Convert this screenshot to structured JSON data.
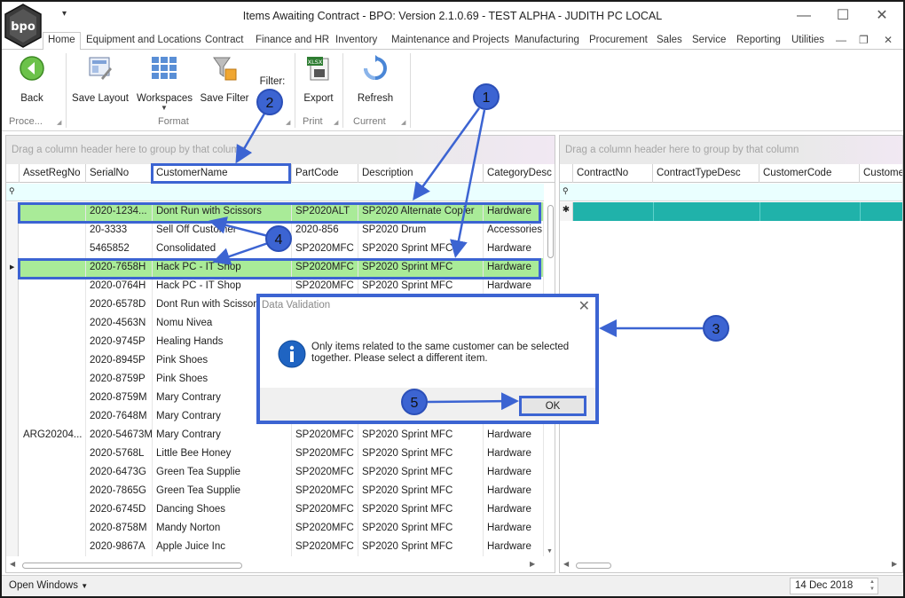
{
  "window": {
    "title": "Items Awaiting Contract - BPO: Version 2.1.0.69 - TEST ALPHA - JUDITH PC LOCAL",
    "logo_text": "bpo",
    "quick_access": "▾",
    "minimize": "—",
    "maximize": "☐",
    "close": "✕"
  },
  "menu": {
    "items": [
      "Home",
      "Equipment and Locations",
      "Contract",
      "Finance and HR",
      "Inventory",
      "Maintenance and Projects",
      "Manufacturing",
      "Procurement",
      "Sales",
      "Service",
      "Reporting",
      "Utilities"
    ],
    "mdi_minimize": "—",
    "mdi_restore": "❐",
    "mdi_close": "✕"
  },
  "ribbon": {
    "back": "Back",
    "save_layout": "Save Layout",
    "workspaces": "Workspaces",
    "save_filter": "Save Filter",
    "filter_label": "Filter:",
    "export": "Export",
    "refresh": "Refresh",
    "groups": {
      "process": "Proce...",
      "format": "Format",
      "print": "Print",
      "current": "Current"
    },
    "xlsx_badge": "XLSX"
  },
  "left_grid": {
    "group_hint": "Drag a column header here to group by that column",
    "columns": [
      "AssetRegNo",
      "SerialNo",
      "CustomerName",
      "PartCode",
      "Description",
      "CategoryDesc"
    ],
    "rows": [
      [
        "",
        "2020-1234...",
        "Dont Run with Scissors",
        "SP2020ALT",
        "SP2020 Alternate Copier",
        "Hardware"
      ],
      [
        "",
        "20-3333",
        "Sell Off Customer",
        "2020-856",
        "SP2020 Drum",
        "Accessories"
      ],
      [
        "",
        "5465852",
        "Consolidated",
        "SP2020MFC",
        "SP2020 Sprint MFC",
        "Hardware"
      ],
      [
        "",
        "2020-7658H",
        "Hack PC - IT Shop",
        "SP2020MFC",
        "SP2020 Sprint MFC",
        "Hardware"
      ],
      [
        "",
        "2020-0764H",
        "Hack PC - IT Shop",
        "SP2020MFC",
        "SP2020 Sprint MFC",
        "Hardware"
      ],
      [
        "",
        "2020-6578D",
        "Dont Run with Scissors",
        "",
        "",
        ""
      ],
      [
        "",
        "2020-4563N",
        "Nomu Nivea",
        "",
        "",
        ""
      ],
      [
        "",
        "2020-9745P",
        "Healing Hands",
        "",
        "",
        ""
      ],
      [
        "",
        "2020-8945P",
        "Pink Shoes",
        "",
        "",
        ""
      ],
      [
        "",
        "2020-8759P",
        "Pink Shoes",
        "",
        "",
        ""
      ],
      [
        "",
        "2020-8759M",
        "Mary Contrary",
        "",
        "",
        ""
      ],
      [
        "",
        "2020-7648M",
        "Mary Contrary",
        "",
        "",
        ""
      ],
      [
        "ARG20204...",
        "2020-54673M",
        "Mary Contrary",
        "SP2020MFC",
        "SP2020 Sprint MFC",
        "Hardware"
      ],
      [
        "",
        "2020-5768L",
        "Little Bee Honey",
        "SP2020MFC",
        "SP2020 Sprint MFC",
        "Hardware"
      ],
      [
        "",
        "2020-6473G",
        "Green Tea Supplie",
        "SP2020MFC",
        "SP2020 Sprint MFC",
        "Hardware"
      ],
      [
        "",
        "2020-7865G",
        "Green Tea Supplie",
        "SP2020MFC",
        "SP2020 Sprint MFC",
        "Hardware"
      ],
      [
        "",
        "2020-6745D",
        "Dancing Shoes",
        "SP2020MFC",
        "SP2020 Sprint MFC",
        "Hardware"
      ],
      [
        "",
        "2020-8758M",
        "Mandy Norton",
        "SP2020MFC",
        "SP2020 Sprint MFC",
        "Hardware"
      ],
      [
        "",
        "2020-9867A",
        "Apple Juice Inc",
        "SP2020MFC",
        "SP2020 Sprint MFC",
        "Hardware"
      ]
    ]
  },
  "right_grid": {
    "group_hint": "Drag a column header here to group by that column",
    "columns": [
      "ContractNo",
      "ContractTypeDesc",
      "CustomerCode",
      "Customer"
    ]
  },
  "dialog": {
    "title": "Data Validation",
    "message": "Only items related to the same customer can be selected together. Please select a different item.",
    "ok": "OK",
    "close": "✕"
  },
  "statusbar": {
    "open_windows": "Open Windows",
    "date": "14 Dec 2018"
  },
  "annotations": [
    "1",
    "2",
    "3",
    "4",
    "5"
  ],
  "colors": {
    "accent": "#3c64d2",
    "selected_row": "#a9eb98",
    "filter_row": "#eaffff",
    "new_row": "#20b2aa"
  }
}
